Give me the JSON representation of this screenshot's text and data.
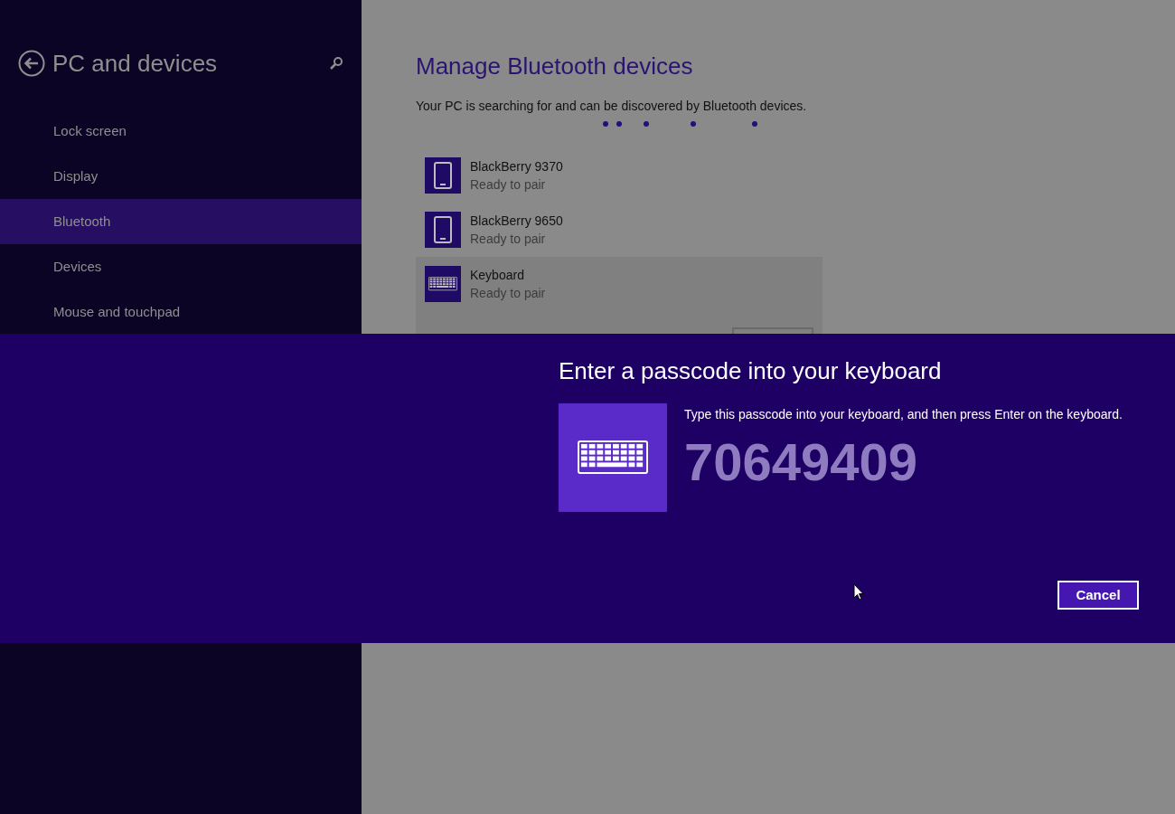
{
  "sidebar": {
    "title": "PC and devices",
    "items": [
      {
        "label": "Lock screen",
        "selected": false
      },
      {
        "label": "Display",
        "selected": false
      },
      {
        "label": "Bluetooth",
        "selected": true
      },
      {
        "label": "Devices",
        "selected": false
      },
      {
        "label": "Mouse and touchpad",
        "selected": false
      }
    ]
  },
  "main": {
    "title": "Manage Bluetooth devices",
    "status": "Your PC is searching for and can be discovered by Bluetooth devices.",
    "devices": [
      {
        "kind": "phone",
        "name": "BlackBerry 9370",
        "status": "Ready to pair",
        "selected": false
      },
      {
        "kind": "phone",
        "name": "BlackBerry 9650",
        "status": "Ready to pair",
        "selected": false
      },
      {
        "kind": "keyboard",
        "name": "Keyboard",
        "status": "Ready to pair",
        "selected": true
      }
    ]
  },
  "dialog": {
    "title": "Enter a passcode into your keyboard",
    "instruction": "Type this passcode into your keyboard, and then press Enter on the keyboard.",
    "passcode": "70649409",
    "cancel": "Cancel"
  }
}
